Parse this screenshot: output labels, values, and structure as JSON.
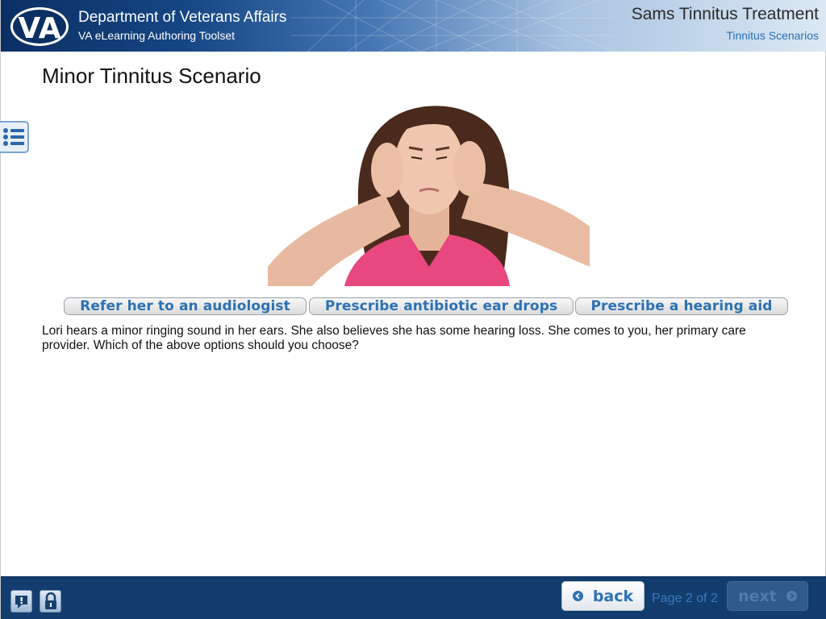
{
  "header": {
    "logo_text": "VA",
    "org_title": "Department of Veterans Affairs",
    "org_subtitle": "VA eLearning Authoring Toolset",
    "course_title": "Sams Tinnitus Treatment",
    "section_title": "Tinnitus Scenarios"
  },
  "main": {
    "page_title": "Minor Tinnitus Scenario",
    "options": [
      {
        "label": "Refer her to an audiologist"
      },
      {
        "label": "Prescribe antibiotic ear drops"
      },
      {
        "label": "Prescribe a hearing aid"
      }
    ],
    "scenario_text": "Lori hears a minor ringing sound in her ears.  She also believes she has some hearing loss.  She comes to you, her primary care provider.  Which of the above options should you choose?"
  },
  "footer": {
    "back_label": "back",
    "page_indicator": "Page 2 of 2",
    "next_label": "next",
    "next_enabled": false
  },
  "icons": {
    "menu": "list-icon",
    "help": "help-bubble-icon",
    "lock": "lock-icon",
    "back": "chevron-left-circle-icon",
    "next": "chevron-right-circle-icon"
  },
  "colors": {
    "header_dark": "#0b2f63",
    "accent_blue": "#2c72b4",
    "footer_bg": "#123d6e",
    "shirt_pink": "#e8487f"
  }
}
